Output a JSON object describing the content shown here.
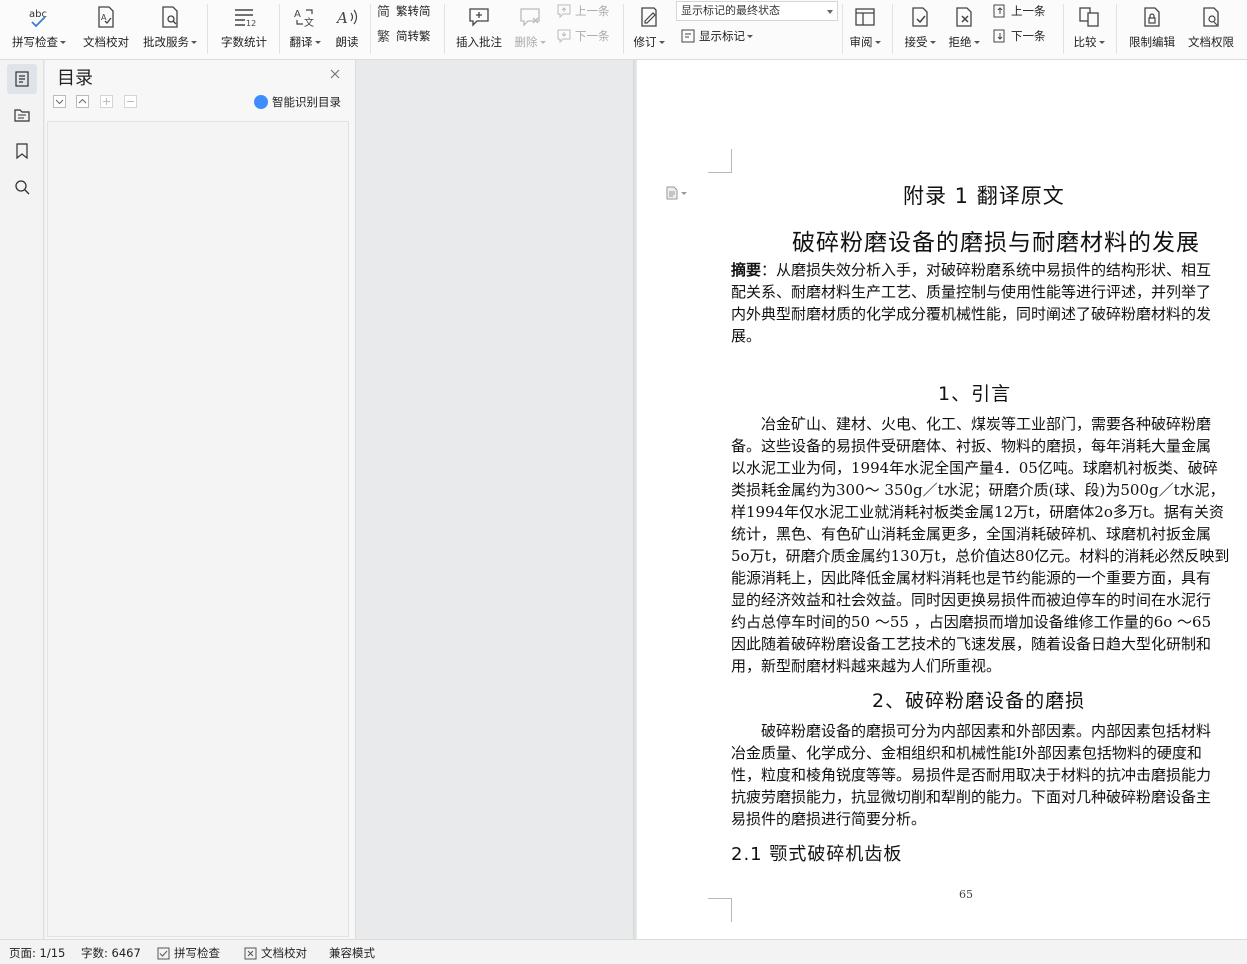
{
  "ribbon": {
    "spell_check": "拼写检查",
    "doc_proofread": "文档校对",
    "review_service": "批改服务",
    "word_count": "字数统计",
    "translate": "翻译",
    "read_aloud": "朗读",
    "trad_to_simp": "繁转简",
    "simp_to_trad": "简转繁",
    "insert_comment": "插入批注",
    "delete": "删除",
    "prev_comment": "上一条",
    "next_comment": "下一条",
    "track_changes": "修订",
    "markup_select": "显示标记的最终状态",
    "show_markup": "显示标记",
    "review_pane": "审阅",
    "accept": "接受",
    "reject": "拒绝",
    "prev_change": "上一条",
    "next_change": "下一条",
    "compare": "比较",
    "restrict_edit": "限制编辑",
    "doc_permission": "文档权限"
  },
  "toc": {
    "title": "目录",
    "smart_detect": "智能识别目录"
  },
  "document": {
    "appendix_title": "附录 1 翻译原文",
    "main_title": "破碎粉磨设备的磨损与耐磨材料的发展",
    "abstract_label": "摘要",
    "abstract_lines": [
      "：从磨损失效分析入手，对破碎粉磨系统中易损件的结构形状、相互",
      "配关系、耐磨材料生产工艺、质量控制与使用性能等进行评述，并列举了",
      "内外典型耐磨材质的化学成分覆机械性能，同时阐述了破碎粉磨材料的发",
      "展。"
    ],
    "section1_title": "1、引言",
    "section1_lines": [
      "　　冶金矿山、建材、火电、化工、煤炭等工业部门，需要各种破碎粉磨",
      "备。这些设备的易损件受研磨体、衬扳、物料的磨损，每年消耗大量金属",
      "以水泥工业为伺，1994年水泥全国产量4．05亿吨。球磨机衬板类、破碎",
      "类损耗金属约为300～  350g／t水泥；研磨介质(球、段)为500g／t水泥，",
      "样1994年仅水泥工业就消耗衬板类金属12万t，研磨体2o多万t。据有关资",
      "统计，黑色、有色矿山消耗金属更多，全国消耗破碎机、球磨机衬扳金属",
      "5o万t，研磨介质金属约130万t，总价值达80亿元。材料的消耗必然反映到",
      "能源消耗上，因此降低金属材料消耗也是节约能源的一个重要方面，具有",
      "显的经济效益和社会效益。同时因更换易损件而被迫停车的时间在水泥行",
      "约占总停车时间的50  ～55  ，占因磨损而增加设备维修工作量的6o  ～65",
      "因此随着破碎粉磨设备工艺技术的飞速发展，随着设备日趋大型化研制和",
      "用，新型耐磨材料越来越为人们所重视。"
    ],
    "section2_title": "2、破碎粉磨设备的磨损",
    "section2_lines": [
      "　　破碎粉磨设备的磨损可分为内部因素和外部因素。内部因素包括材料",
      "冶金质量、化学成分、金相组织和机械性能I外部因素包括物料的硬度和",
      "性，粒度和棱角锐度等等。易损件是否耐用取决于材料的抗冲击磨损能力",
      "抗疲劳磨损能力，抗显微切削和犁削的能力。下面对几种破碎粉磨设备主",
      "易损件的磨损进行简要分析。"
    ],
    "subsection_title": "2.1  颚式破碎机齿板",
    "page_number": "65"
  },
  "status": {
    "page": "页面: 1/15",
    "words": "字数: 6467",
    "spell_check": "拼写检查",
    "doc_proofread": "文档校对",
    "compat_mode": "兼容模式"
  }
}
